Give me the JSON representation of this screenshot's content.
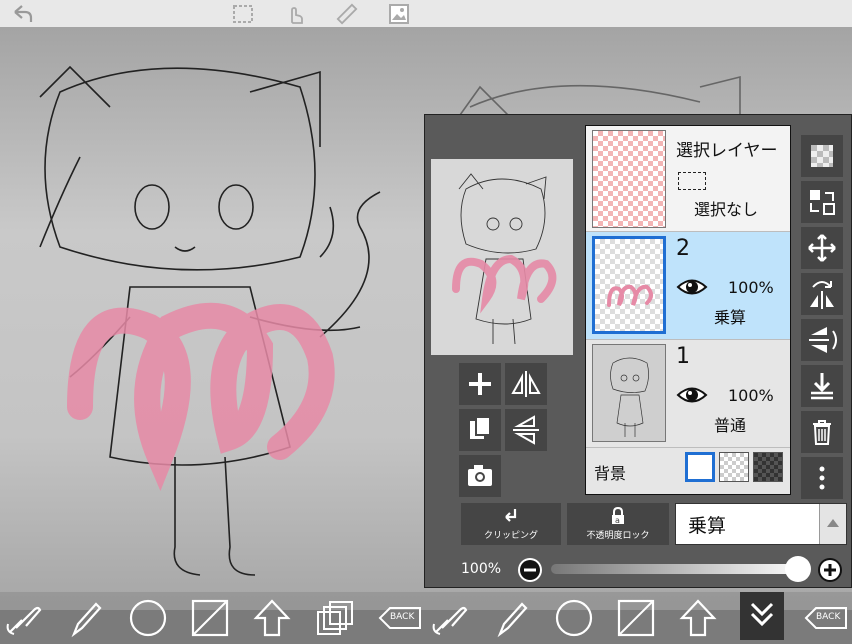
{
  "icons": {
    "undo": "undo-icon",
    "selection": "selection-tool-icon",
    "touch": "touch-icon",
    "ruler": "ruler-icon",
    "image": "image-icon",
    "collapse": "chevron-down-double-icon"
  },
  "layers_panel": {
    "selection_layer": {
      "title": "選択レイヤー",
      "status": "選択なし"
    },
    "layers": [
      {
        "number": "2",
        "opacity": "100%",
        "blend": "乗算",
        "selected": true
      },
      {
        "number": "1",
        "opacity": "100%",
        "blend": "普通",
        "selected": false
      }
    ],
    "background": {
      "label": "背景"
    },
    "clipping_label": "クリッピング",
    "alpha_lock_label": "不透明度ロック",
    "blend_mode_value": "乗算",
    "opacity_label": "100%"
  },
  "bottom_toolbar": {
    "back_label": "BACK",
    "back_label_2": "BACK"
  },
  "colors": {
    "stroke_pink": "#e68aa6",
    "selected_blue": "#1f6fd3",
    "panel_bg": "#5a5a5a"
  }
}
